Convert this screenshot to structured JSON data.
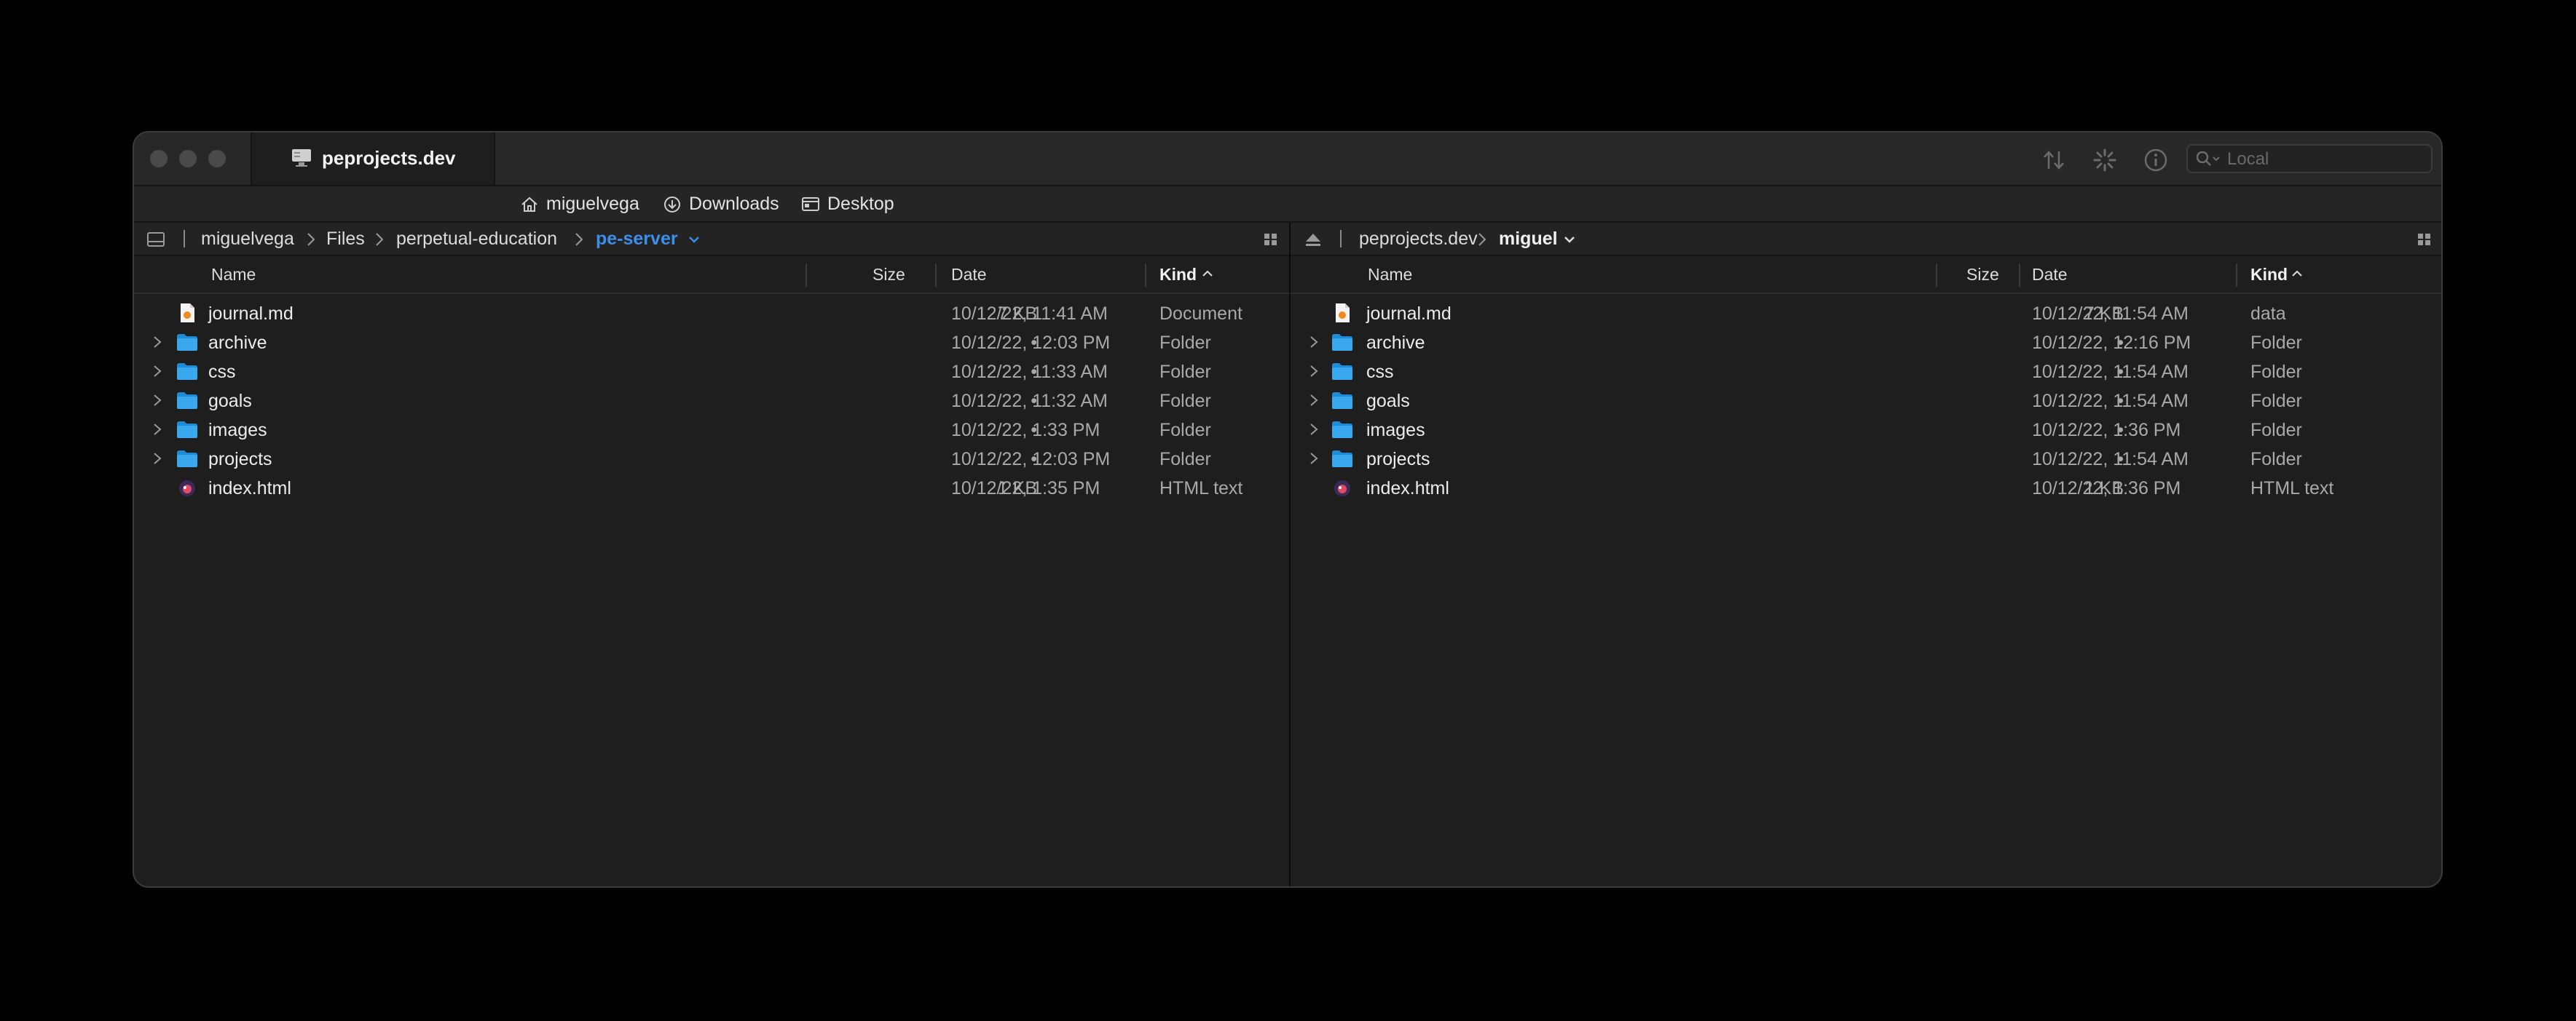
{
  "window": {
    "tab_title": "peprojects.dev",
    "search_placeholder": "Local"
  },
  "favorites": [
    {
      "label": "miguelvega",
      "icon": "home-icon"
    },
    {
      "label": "Downloads",
      "icon": "download-icon"
    },
    {
      "label": "Desktop",
      "icon": "desktop-icon"
    }
  ],
  "left": {
    "path": [
      "miguelvega",
      "Files",
      "perpetual-education",
      "pe-server"
    ],
    "columns": {
      "name": "Name",
      "size": "Size",
      "date": "Date",
      "kind": "Kind"
    },
    "rows": [
      {
        "name": "journal.md",
        "size": "7 KB",
        "date": "10/12/22, 11:41 AM",
        "kind": "Document",
        "type": "file-md"
      },
      {
        "name": "archive",
        "size": "•",
        "date": "10/12/22, 12:03 PM",
        "kind": "Folder",
        "type": "folder"
      },
      {
        "name": "css",
        "size": "•",
        "date": "10/12/22, 11:33 AM",
        "kind": "Folder",
        "type": "folder"
      },
      {
        "name": "goals",
        "size": "•",
        "date": "10/12/22, 11:32 AM",
        "kind": "Folder",
        "type": "folder"
      },
      {
        "name": "images",
        "size": "•",
        "date": "10/12/22, 1:33 PM",
        "kind": "Folder",
        "type": "folder"
      },
      {
        "name": "projects",
        "size": "•",
        "date": "10/12/22, 12:03 PM",
        "kind": "Folder",
        "type": "folder"
      },
      {
        "name": "index.html",
        "size": "1 KB",
        "date": "10/12/22, 1:35 PM",
        "kind": "HTML text",
        "type": "file-html"
      }
    ]
  },
  "right": {
    "path": [
      "peprojects.dev",
      "miguel"
    ],
    "columns": {
      "name": "Name",
      "size": "Size",
      "date": "Date",
      "kind": "Kind"
    },
    "rows": [
      {
        "name": "journal.md",
        "size": "7 KB",
        "date": "10/12/22, 11:54 AM",
        "kind": "data",
        "type": "file-md"
      },
      {
        "name": "archive",
        "size": "•",
        "date": "10/12/22, 12:16 PM",
        "kind": "Folder",
        "type": "folder"
      },
      {
        "name": "css",
        "size": "•",
        "date": "10/12/22, 11:54 AM",
        "kind": "Folder",
        "type": "folder"
      },
      {
        "name": "goals",
        "size": "•",
        "date": "10/12/22, 11:54 AM",
        "kind": "Folder",
        "type": "folder"
      },
      {
        "name": "images",
        "size": "•",
        "date": "10/12/22, 1:36 PM",
        "kind": "Folder",
        "type": "folder"
      },
      {
        "name": "projects",
        "size": "•",
        "date": "10/12/22, 11:54 AM",
        "kind": "Folder",
        "type": "folder"
      },
      {
        "name": "index.html",
        "size": "1 KB",
        "date": "10/12/22, 1:36 PM",
        "kind": "HTML text",
        "type": "file-html"
      }
    ]
  },
  "colors": {
    "accent": "#3b8eea",
    "folder": "#3aa8ee"
  }
}
